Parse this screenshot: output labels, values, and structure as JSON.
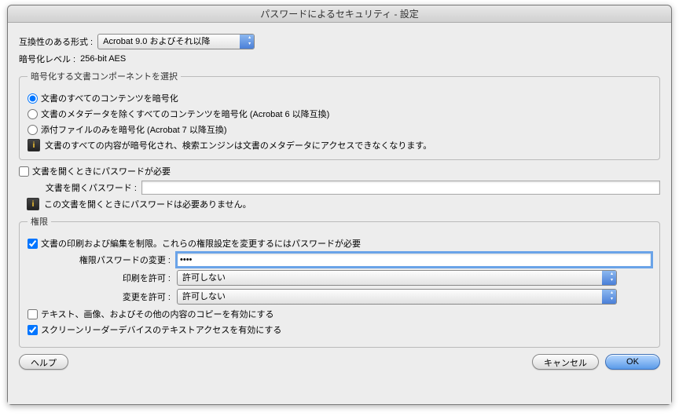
{
  "title": "パスワードによるセキュリティ - 設定",
  "compat": {
    "label": "互換性のある形式 :",
    "value": "Acrobat 9.0 およびそれ以降"
  },
  "encrypt_level": {
    "label": "暗号化レベル :",
    "value": "256-bit AES"
  },
  "components": {
    "legend": "暗号化する文書コンポーネントを選択",
    "opt_all": "文書のすべてのコンテンツを暗号化",
    "opt_meta": "文書のメタデータを除くすべてのコンテンツを暗号化 (Acrobat 6 以降互換)",
    "opt_attach": "添付ファイルのみを暗号化 (Acrobat 7 以降互換)",
    "info": "文書のすべての内容が暗号化され、検索エンジンは文書のメタデータにアクセスできなくなります。"
  },
  "open_pw": {
    "check": "文書を開くときにパスワードが必要",
    "label": "文書を開くパスワード :",
    "value": "",
    "info": "この文書を開くときにパスワードは必要ありません。"
  },
  "perm": {
    "legend": "権限",
    "check": "文書の印刷および編集を制限。これらの権限設定を変更するにはパスワードが必要",
    "pw_label": "権限パスワードの変更 :",
    "pw_value": "••••",
    "print_label": "印刷を許可 :",
    "print_value": "許可しない",
    "change_label": "変更を許可 :",
    "change_value": "許可しない",
    "copy_check": "テキスト、画像、およびその他の内容のコピーを有効にする",
    "reader_check": "スクリーンリーダーデバイスのテキストアクセスを有効にする"
  },
  "buttons": {
    "help": "ヘルプ",
    "cancel": "キャンセル",
    "ok": "OK"
  }
}
